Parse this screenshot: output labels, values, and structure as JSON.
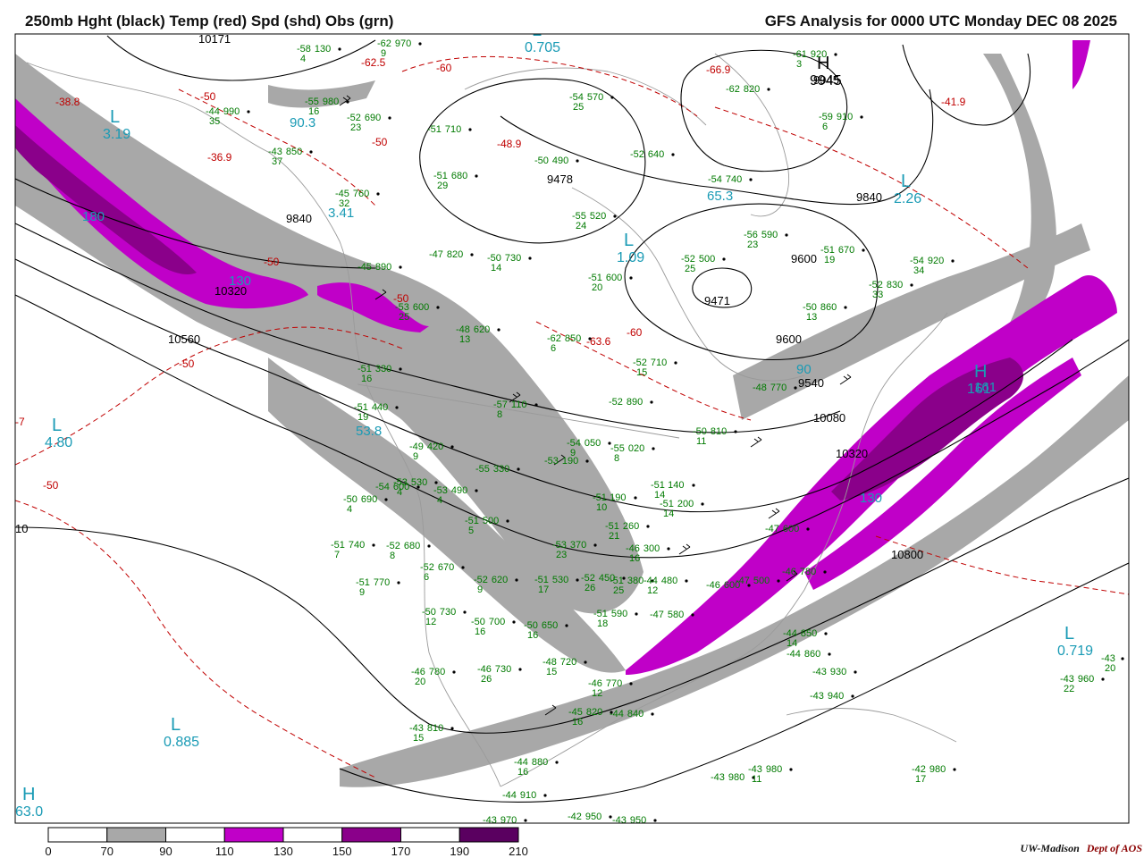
{
  "header": {
    "left_title": "250mb Hght (black) Temp (red) Spd (shd) Obs (grn)",
    "right_title": "GFS Analysis for 0000 UTC Monday  DEC 08 2025"
  },
  "colors": {
    "height_contour": "#000000",
    "temp_contour": "#c00000",
    "obs": "#007a00",
    "pressure_center": "#1a9bb5",
    "map_outline": "#9a9a9a",
    "speed_70_90": "#a8a8a8",
    "speed_110_130": "#c000c8",
    "speed_150_170": "#8a008a",
    "speed_190_210": "#5a0060"
  },
  "legend": {
    "labels": [
      "0",
      "70",
      "90",
      "110",
      "130",
      "150",
      "170",
      "190",
      "210"
    ],
    "bins": [
      {
        "from": "0",
        "to": "70",
        "color": "#ffffff"
      },
      {
        "from": "70",
        "to": "90",
        "color": "#a8a8a8"
      },
      {
        "from": "90",
        "to": "110",
        "color": "#ffffff"
      },
      {
        "from": "110",
        "to": "130",
        "color": "#c000c8"
      },
      {
        "from": "130",
        "to": "150",
        "color": "#ffffff"
      },
      {
        "from": "150",
        "to": "170",
        "color": "#8a008a"
      },
      {
        "from": "170",
        "to": "190",
        "color": "#ffffff"
      },
      {
        "from": "190",
        "to": "210",
        "color": "#5a0060"
      }
    ]
  },
  "credit": {
    "org": "UW-Madison",
    "dept": "Dept of AOS"
  },
  "height_labels": [
    "10171",
    "9945",
    "9478",
    "9840",
    "9840",
    "9600",
    "9471",
    "9600",
    "9540",
    "10080",
    "10320",
    "10320",
    "10560",
    "10800",
    "10"
  ],
  "temp_labels": [
    "-62.5",
    "-60",
    "-50",
    "-50",
    "-66.9",
    "-48.9",
    "-36.9",
    "-38.8",
    "-41.9",
    "-50",
    "-50",
    "-63.6",
    "-60",
    "-50",
    "-50",
    "-7"
  ],
  "centers": [
    {
      "type": "L",
      "value": "3.19"
    },
    {
      "type": "L",
      "value": "0.705"
    },
    {
      "type": "L",
      "value": "1.09"
    },
    {
      "type": "L",
      "value": "2.26"
    },
    {
      "type": "L",
      "value": "4.80"
    },
    {
      "type": "L",
      "value": "0.885"
    },
    {
      "type": "L",
      "value": "0.719"
    },
    {
      "type": "H",
      "value": "63.0"
    },
    {
      "type": "H",
      "value": "161"
    },
    {
      "type": "H",
      "value": "9945"
    }
  ],
  "speed_labels": [
    "180",
    "130",
    "130",
    "161",
    "53.8",
    "65.3",
    "90",
    "3.41",
    "90.3"
  ],
  "observations": [
    {
      "t": "-58",
      "h": "130",
      "d": "4"
    },
    {
      "t": "-62",
      "h": "970",
      "d": "9"
    },
    {
      "t": "-55",
      "h": "980",
      "d": "16"
    },
    {
      "t": "-44",
      "h": "990",
      "d": "35"
    },
    {
      "t": "-52",
      "h": "690",
      "d": "23"
    },
    {
      "t": "-43",
      "h": "850",
      "d": "37"
    },
    {
      "t": "-54",
      "h": "570",
      "d": "25"
    },
    {
      "t": "-51",
      "h": "710",
      "d": ""
    },
    {
      "t": "-51",
      "h": "680",
      "d": "29"
    },
    {
      "t": "-50",
      "h": "490",
      "d": ""
    },
    {
      "t": "-52",
      "h": "640",
      "d": ""
    },
    {
      "t": "-61",
      "h": "920",
      "d": "3"
    },
    {
      "t": "-62",
      "h": "820",
      "d": ""
    },
    {
      "t": "-59",
      "h": "910",
      "d": "6"
    },
    {
      "t": "-54",
      "h": "740",
      "d": ""
    },
    {
      "t": "-45",
      "h": "760",
      "d": "32"
    },
    {
      "t": "-55",
      "h": "520",
      "d": "24"
    },
    {
      "t": "-47",
      "h": "820",
      "d": ""
    },
    {
      "t": "-50",
      "h": "730",
      "d": "14"
    },
    {
      "t": "-52",
      "h": "500",
      "d": "25"
    },
    {
      "t": "-56",
      "h": "590",
      "d": "23"
    },
    {
      "t": "-51",
      "h": "670",
      "d": "19"
    },
    {
      "t": "-54",
      "h": "920",
      "d": "34"
    },
    {
      "t": "-52",
      "h": "830",
      "d": "33"
    },
    {
      "t": "-45",
      "h": "890",
      "d": ""
    },
    {
      "t": "-53",
      "h": "600",
      "d": "25"
    },
    {
      "t": "-51",
      "h": "600",
      "d": "20"
    },
    {
      "t": "-48",
      "h": "620",
      "d": "13"
    },
    {
      "t": "-62",
      "h": "850",
      "d": "6"
    },
    {
      "t": "-50",
      "h": "860",
      "d": "13"
    },
    {
      "t": "-51",
      "h": "330",
      "d": "16"
    },
    {
      "t": "-52",
      "h": "710",
      "d": "15"
    },
    {
      "t": "-48",
      "h": "770",
      "d": ""
    },
    {
      "t": "-51",
      "h": "440",
      "d": "19"
    },
    {
      "t": "-57",
      "h": "110",
      "d": "8"
    },
    {
      "t": "-52",
      "h": "890",
      "d": ""
    },
    {
      "t": "-50",
      "h": "810",
      "d": "11"
    },
    {
      "t": "-49",
      "h": "420",
      "d": "9"
    },
    {
      "t": "-54",
      "h": "050",
      "d": "9"
    },
    {
      "t": "-55",
      "h": "020",
      "d": "8"
    },
    {
      "t": "-55",
      "h": "330",
      "d": ""
    },
    {
      "t": "-53",
      "h": "190",
      "d": ""
    },
    {
      "t": "-53",
      "h": "530",
      "d": "4"
    },
    {
      "t": "-53",
      "h": "490",
      "d": "4"
    },
    {
      "t": "-54",
      "h": "600",
      "d": ""
    },
    {
      "t": "-50",
      "h": "690",
      "d": "4"
    },
    {
      "t": "-51",
      "h": "190",
      "d": "10"
    },
    {
      "t": "-51",
      "h": "140",
      "d": "14"
    },
    {
      "t": "-51",
      "h": "200",
      "d": "14"
    },
    {
      "t": "-51",
      "h": "260",
      "d": "21"
    },
    {
      "t": "-51",
      "h": "500",
      "d": "5"
    },
    {
      "t": "-51",
      "h": "740",
      "d": "7"
    },
    {
      "t": "-52",
      "h": "680",
      "d": "8"
    },
    {
      "t": "-52",
      "h": "670",
      "d": "6"
    },
    {
      "t": "-51",
      "h": "770",
      "d": "9"
    },
    {
      "t": "-52",
      "h": "620",
      "d": "9"
    },
    {
      "t": "-51",
      "h": "530",
      "d": "17"
    },
    {
      "t": "-53",
      "h": "370",
      "d": "23"
    },
    {
      "t": "-46",
      "h": "300",
      "d": "16"
    },
    {
      "t": "-51",
      "h": "380",
      "d": "25"
    },
    {
      "t": "-52",
      "h": "450",
      "d": "26"
    },
    {
      "t": "-44",
      "h": "480",
      "d": "12"
    },
    {
      "t": "-46",
      "h": "600",
      "d": ""
    },
    {
      "t": "-47",
      "h": "500",
      "d": ""
    },
    {
      "t": "-47",
      "h": "600",
      "d": ""
    },
    {
      "t": "-46",
      "h": "780",
      "d": ""
    },
    {
      "t": "-50",
      "h": "730",
      "d": "12"
    },
    {
      "t": "-50",
      "h": "700",
      "d": "16"
    },
    {
      "t": "-50",
      "h": "650",
      "d": "16"
    },
    {
      "t": "-51",
      "h": "590",
      "d": "18"
    },
    {
      "t": "-47",
      "h": "580",
      "d": ""
    },
    {
      "t": "-48",
      "h": "720",
      "d": "15"
    },
    {
      "t": "-46",
      "h": "780",
      "d": "20"
    },
    {
      "t": "-46",
      "h": "730",
      "d": "26"
    },
    {
      "t": "-46",
      "h": "770",
      "d": "12"
    },
    {
      "t": "-45",
      "h": "820",
      "d": "16"
    },
    {
      "t": "-44",
      "h": "840",
      "d": ""
    },
    {
      "t": "-44",
      "h": "850",
      "d": "14"
    },
    {
      "t": "-44",
      "h": "860",
      "d": ""
    },
    {
      "t": "-43",
      "h": "930",
      "d": ""
    },
    {
      "t": "-43",
      "h": "940",
      "d": ""
    },
    {
      "t": "-43",
      "h": "810",
      "d": "15"
    },
    {
      "t": "-44",
      "h": "880",
      "d": "16"
    },
    {
      "t": "-44",
      "h": "910",
      "d": ""
    },
    {
      "t": "-43",
      "h": "980",
      "d": ""
    },
    {
      "t": "-43",
      "h": "980",
      "d": "11"
    },
    {
      "t": "-42",
      "h": "980",
      "d": "17"
    },
    {
      "t": "-43",
      "h": "970",
      "d": ""
    },
    {
      "t": "-42",
      "h": "950",
      "d": ""
    },
    {
      "t": "-43",
      "h": "950",
      "d": ""
    },
    {
      "t": "-43",
      "h": "960",
      "d": "22"
    },
    {
      "t": "-43",
      "h": "",
      "d": "20"
    }
  ]
}
